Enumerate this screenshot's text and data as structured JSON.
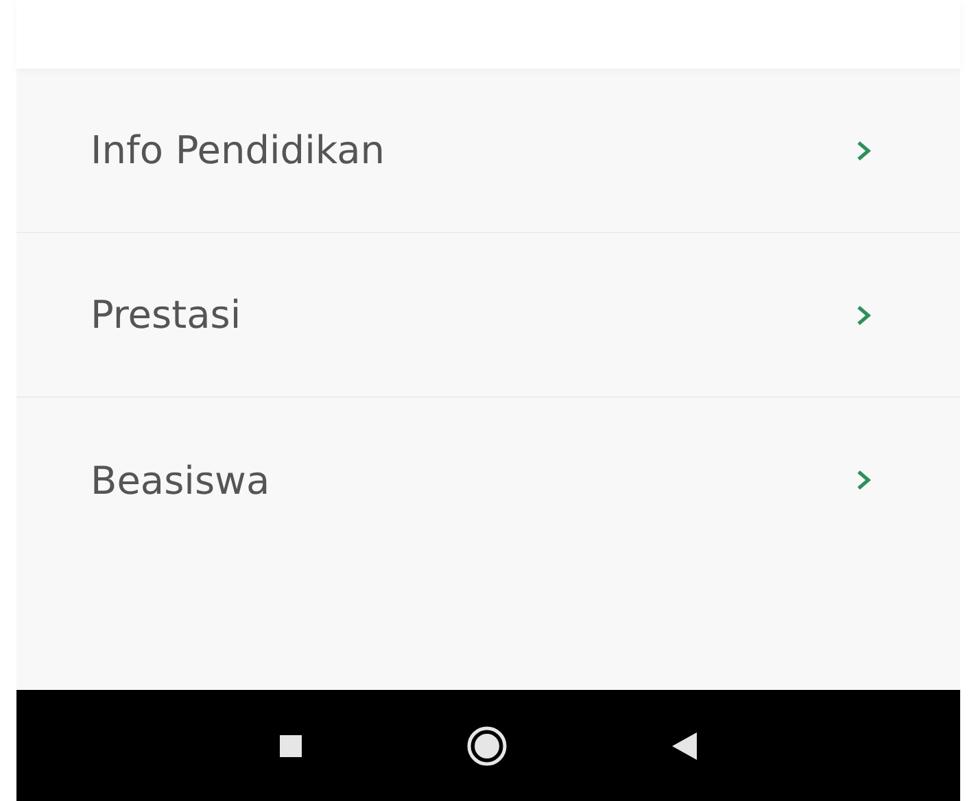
{
  "menu": [
    {
      "label": "Info Pendidikan"
    },
    {
      "label": "Prestasi"
    },
    {
      "label": "Beasiswa"
    }
  ]
}
